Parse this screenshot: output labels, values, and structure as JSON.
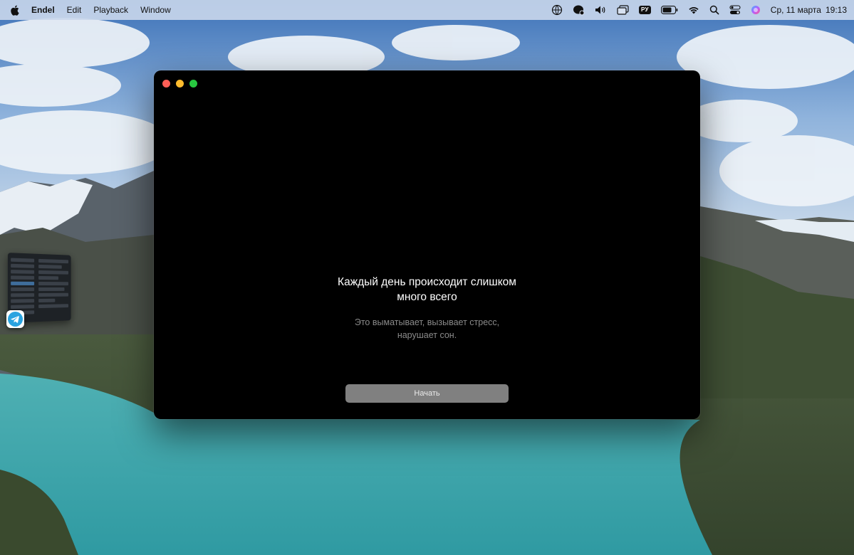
{
  "menubar": {
    "app_name": "Endel",
    "menus": [
      "Edit",
      "Playback",
      "Window"
    ],
    "status_icons": [
      "globe-icon",
      "chat-bubble-icon",
      "speaker-icon",
      "windows-icon",
      "keyboard-layout-icon",
      "battery-icon",
      "wifi-icon",
      "search-icon",
      "control-center-icon",
      "siri-icon"
    ],
    "keyboard_layout": "РУ",
    "date": "Ср, 11 марта",
    "time": "19:13"
  },
  "app_window": {
    "headline": "Каждый день происходит слишком много всего",
    "subtext": "Это выматывает, вызывает стресс, нарушает сон.",
    "start_button": "Начать"
  },
  "colors": {
    "window_bg": "#000000",
    "button_bg": "#808080",
    "close": "#fe5f57",
    "minimize": "#febc2e",
    "maximize": "#28c840"
  }
}
